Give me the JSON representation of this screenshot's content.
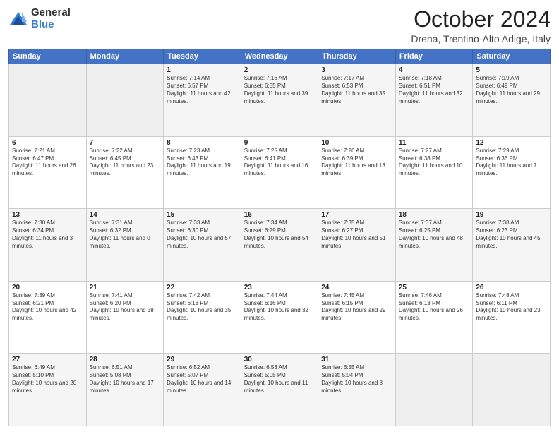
{
  "logo": {
    "general": "General",
    "blue": "Blue"
  },
  "header": {
    "title": "October 2024",
    "location": "Drena, Trentino-Alto Adige, Italy"
  },
  "days_of_week": [
    "Sunday",
    "Monday",
    "Tuesday",
    "Wednesday",
    "Thursday",
    "Friday",
    "Saturday"
  ],
  "weeks": [
    [
      {
        "num": "",
        "info": ""
      },
      {
        "num": "",
        "info": ""
      },
      {
        "num": "1",
        "info": "Sunrise: 7:14 AM\nSunset: 6:57 PM\nDaylight: 11 hours and 42 minutes."
      },
      {
        "num": "2",
        "info": "Sunrise: 7:16 AM\nSunset: 6:55 PM\nDaylight: 11 hours and 39 minutes."
      },
      {
        "num": "3",
        "info": "Sunrise: 7:17 AM\nSunset: 6:53 PM\nDaylight: 11 hours and 35 minutes."
      },
      {
        "num": "4",
        "info": "Sunrise: 7:18 AM\nSunset: 6:51 PM\nDaylight: 11 hours and 32 minutes."
      },
      {
        "num": "5",
        "info": "Sunrise: 7:19 AM\nSunset: 6:49 PM\nDaylight: 11 hours and 29 minutes."
      }
    ],
    [
      {
        "num": "6",
        "info": "Sunrise: 7:21 AM\nSunset: 6:47 PM\nDaylight: 11 hours and 26 minutes."
      },
      {
        "num": "7",
        "info": "Sunrise: 7:22 AM\nSunset: 6:45 PM\nDaylight: 11 hours and 23 minutes."
      },
      {
        "num": "8",
        "info": "Sunrise: 7:23 AM\nSunset: 6:43 PM\nDaylight: 11 hours and 19 minutes."
      },
      {
        "num": "9",
        "info": "Sunrise: 7:25 AM\nSunset: 6:41 PM\nDaylight: 11 hours and 16 minutes."
      },
      {
        "num": "10",
        "info": "Sunrise: 7:26 AM\nSunset: 6:39 PM\nDaylight: 11 hours and 13 minutes."
      },
      {
        "num": "11",
        "info": "Sunrise: 7:27 AM\nSunset: 6:38 PM\nDaylight: 11 hours and 10 minutes."
      },
      {
        "num": "12",
        "info": "Sunrise: 7:29 AM\nSunset: 6:36 PM\nDaylight: 11 hours and 7 minutes."
      }
    ],
    [
      {
        "num": "13",
        "info": "Sunrise: 7:30 AM\nSunset: 6:34 PM\nDaylight: 11 hours and 3 minutes."
      },
      {
        "num": "14",
        "info": "Sunrise: 7:31 AM\nSunset: 6:32 PM\nDaylight: 11 hours and 0 minutes."
      },
      {
        "num": "15",
        "info": "Sunrise: 7:33 AM\nSunset: 6:30 PM\nDaylight: 10 hours and 57 minutes."
      },
      {
        "num": "16",
        "info": "Sunrise: 7:34 AM\nSunset: 6:29 PM\nDaylight: 10 hours and 54 minutes."
      },
      {
        "num": "17",
        "info": "Sunrise: 7:35 AM\nSunset: 6:27 PM\nDaylight: 10 hours and 51 minutes."
      },
      {
        "num": "18",
        "info": "Sunrise: 7:37 AM\nSunset: 6:25 PM\nDaylight: 10 hours and 48 minutes."
      },
      {
        "num": "19",
        "info": "Sunrise: 7:38 AM\nSunset: 6:23 PM\nDaylight: 10 hours and 45 minutes."
      }
    ],
    [
      {
        "num": "20",
        "info": "Sunrise: 7:39 AM\nSunset: 6:21 PM\nDaylight: 10 hours and 42 minutes."
      },
      {
        "num": "21",
        "info": "Sunrise: 7:41 AM\nSunset: 6:20 PM\nDaylight: 10 hours and 38 minutes."
      },
      {
        "num": "22",
        "info": "Sunrise: 7:42 AM\nSunset: 6:18 PM\nDaylight: 10 hours and 35 minutes."
      },
      {
        "num": "23",
        "info": "Sunrise: 7:44 AM\nSunset: 6:16 PM\nDaylight: 10 hours and 32 minutes."
      },
      {
        "num": "24",
        "info": "Sunrise: 7:45 AM\nSunset: 6:15 PM\nDaylight: 10 hours and 29 minutes."
      },
      {
        "num": "25",
        "info": "Sunrise: 7:46 AM\nSunset: 6:13 PM\nDaylight: 10 hours and 26 minutes."
      },
      {
        "num": "26",
        "info": "Sunrise: 7:48 AM\nSunset: 6:11 PM\nDaylight: 10 hours and 23 minutes."
      }
    ],
    [
      {
        "num": "27",
        "info": "Sunrise: 6:49 AM\nSunset: 5:10 PM\nDaylight: 10 hours and 20 minutes."
      },
      {
        "num": "28",
        "info": "Sunrise: 6:51 AM\nSunset: 5:08 PM\nDaylight: 10 hours and 17 minutes."
      },
      {
        "num": "29",
        "info": "Sunrise: 6:52 AM\nSunset: 5:07 PM\nDaylight: 10 hours and 14 minutes."
      },
      {
        "num": "30",
        "info": "Sunrise: 6:53 AM\nSunset: 5:05 PM\nDaylight: 10 hours and 11 minutes."
      },
      {
        "num": "31",
        "info": "Sunrise: 6:55 AM\nSunset: 5:04 PM\nDaylight: 10 hours and 8 minutes."
      },
      {
        "num": "",
        "info": ""
      },
      {
        "num": "",
        "info": ""
      }
    ]
  ]
}
